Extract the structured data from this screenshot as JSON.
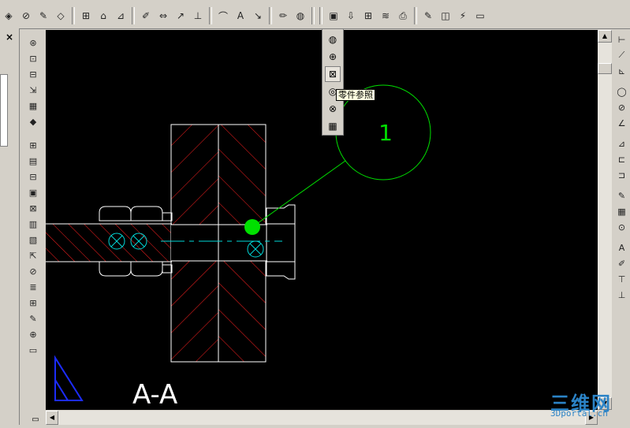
{
  "toolbar": {
    "icons": [
      "part-icon",
      "datum-icon",
      "feature-icon",
      "sketch-icon",
      "edit-icon",
      "view-icon",
      "section-icon",
      "hatch-icon",
      "dimension-icon",
      "leader-icon",
      "note-icon",
      "symbol-icon",
      "balloon-icon",
      "pencil-icon",
      "reference-icon",
      "layer-icon",
      "sheet-icon",
      "table-icon",
      "format-icon",
      "print-icon"
    ]
  },
  "flyout": {
    "tooltip": "零件参照",
    "icons": [
      "reference-sphere-icon",
      "zoom-icon",
      "cross-icon",
      "reference-part-icon",
      "delete-reference-icon",
      "grid-reference-icon"
    ]
  },
  "drawing": {
    "balloon_number": "1",
    "section_label": "A-A"
  },
  "watermark": {
    "main": "三维网",
    "sub": "3Dportal.cn"
  },
  "colors": {
    "canvas": "#000000",
    "outline": "#ffffff",
    "hatch": "#ff2020",
    "balloon": "#00e000",
    "centerline": "#00d8d8",
    "triangle": "#1c2cff"
  }
}
